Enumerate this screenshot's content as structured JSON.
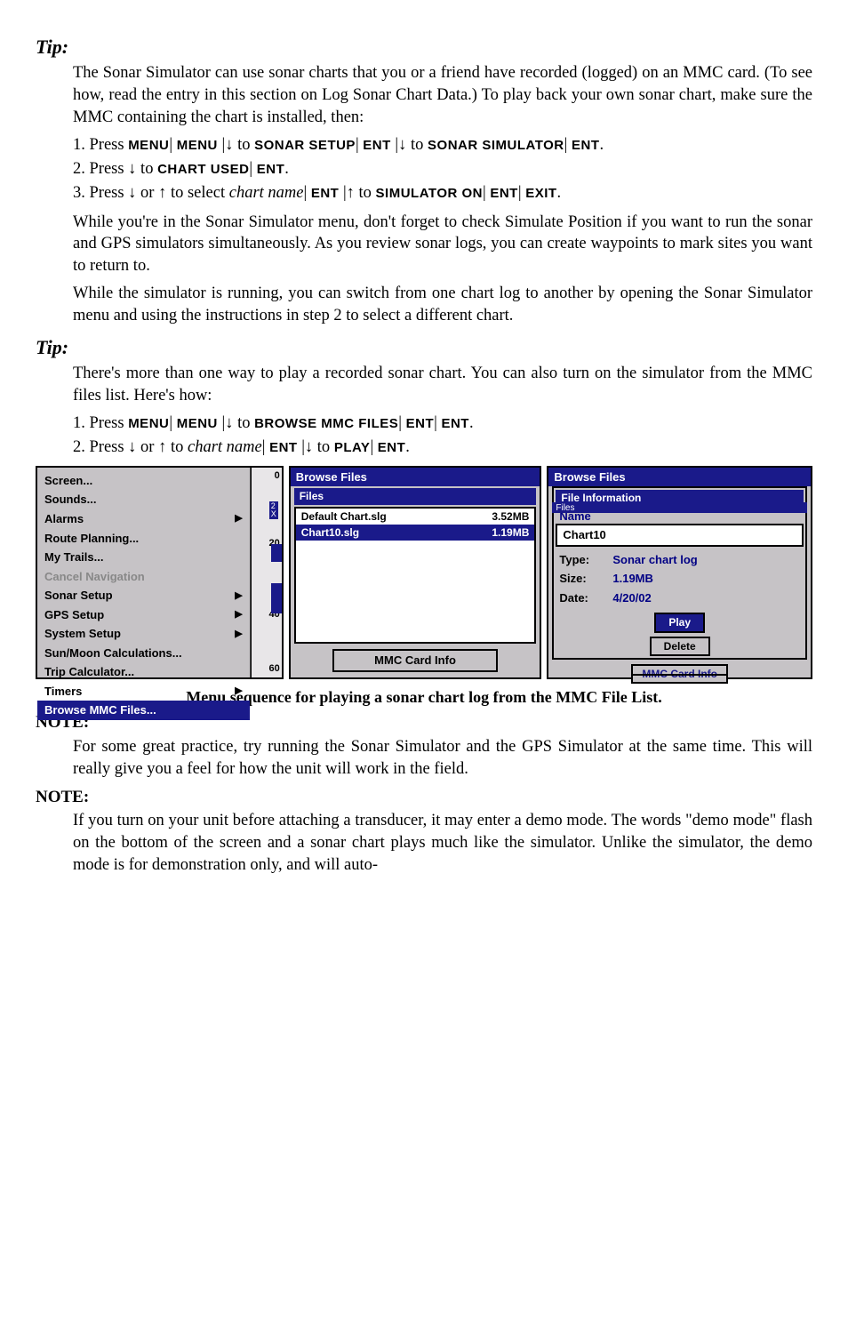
{
  "tip1": {
    "heading": "Tip:",
    "para": "The Sonar Simulator can use sonar charts that you or a friend have recorded (logged) on an MMC card. (To see how, read the entry in this section on Log Sonar Chart Data.) To play back your own sonar chart, make sure the MMC containing the chart is installed, then:",
    "step1_a": "1. Press ",
    "step1_b": "|↓ to ",
    "step1_c": "|↓ to ",
    "step1_menu": "MENU",
    "step1_menu2": "MENU",
    "step1_sonar": "SONAR SETUP",
    "step1_sim": "SONAR SIMULATOR",
    "step1_ent": "ENT",
    "step2_a": "2. Press ↓ to ",
    "step2_chart": "CHART USED",
    "step2_ent": "ENT",
    "step3_a": "3. Press ↓ or ↑ to select ",
    "step3_name": "chart name",
    "step3_b": "|↑ to ",
    "step3_ent": "ENT",
    "step3_sim": "SIMULATOR ON",
    "step3_ent2": "ENT",
    "step3_exit": "EXIT",
    "para2": "While you're in the Sonar Simulator menu, don't forget to check Simulate Position if you want to run the sonar and GPS simulators simultaneously. As you review sonar logs, you can create waypoints to mark sites you want to return to.",
    "para3": "While the simulator is running, you can switch from one chart log to another by opening the Sonar Simulator menu and using the instructions in step 2 to select a different chart."
  },
  "tip2": {
    "heading": "Tip:",
    "para": "There's more than one way to play a recorded sonar chart. You can also turn on the simulator from the MMC files list. Here's how:",
    "s1_a": "1. Press ",
    "s1_menu": "MENU",
    "s1_b": "|↓ to ",
    "s1_browse": "BROWSE MMC FILES",
    "s1_ent": "ENT",
    "s1_ent2": "ENT",
    "s2_a": "2. Press ↓ or ↑ to ",
    "s2_name": "chart name",
    "s2_ent": "ENT",
    "s2_b": "|↓ to ",
    "s2_play": "PLAY",
    "s2_ent2": "ENT"
  },
  "menu": {
    "items": [
      {
        "label": "Screen...",
        "arrow": false,
        "disabled": false
      },
      {
        "label": "Sounds...",
        "arrow": false,
        "disabled": false
      },
      {
        "label": "Alarms",
        "arrow": true,
        "disabled": false
      },
      {
        "label": "Route Planning...",
        "arrow": false,
        "disabled": false
      },
      {
        "label": "My Trails...",
        "arrow": false,
        "disabled": false
      },
      {
        "label": "Cancel Navigation",
        "arrow": false,
        "disabled": true
      },
      {
        "label": "Sonar Setup",
        "arrow": true,
        "disabled": false
      },
      {
        "label": "GPS Setup",
        "arrow": true,
        "disabled": false
      },
      {
        "label": "System Setup",
        "arrow": true,
        "disabled": false
      },
      {
        "label": "Sun/Moon Calculations...",
        "arrow": false,
        "disabled": false
      },
      {
        "label": "Trip Calculator...",
        "arrow": false,
        "disabled": false
      },
      {
        "label": "Timers",
        "arrow": true,
        "disabled": false
      },
      {
        "label": "Browse MMC Files...",
        "arrow": false,
        "disabled": false,
        "selected": true
      }
    ],
    "ruler": {
      "top": "0",
      "mid": "20",
      "mid2": "40",
      "bot": "60",
      "label2x": "2\nX"
    }
  },
  "browse": {
    "title": "Browse Files",
    "subtitle": "Files",
    "rows": [
      {
        "name": "Default Chart.slg",
        "size": "3.52MB"
      },
      {
        "name": "Chart10.slg",
        "size": "1.19MB",
        "selected": true
      }
    ],
    "btn": "MMC Card Info"
  },
  "info": {
    "title": "Browse Files",
    "strike": "Files",
    "sub": "File Information",
    "name_lbl": "Name",
    "name_val": "Chart10",
    "rows": [
      {
        "lbl": "Type:",
        "val": "Sonar chart log"
      },
      {
        "lbl": "Size:",
        "val": "1.19MB"
      },
      {
        "lbl": "Date:",
        "val": "4/20/02"
      }
    ],
    "play": "Play",
    "delete": "Delete",
    "card": "MMC Card Info"
  },
  "caption": "Menu sequence for playing a sonar chart log from the MMC File List.",
  "note1": {
    "heading": "NOTE:",
    "para": "For some great practice, try running the Sonar Simulator and the GPS Simulator at the same time. This will really give you a feel for how the unit will work in the field."
  },
  "note2": {
    "heading": "NOTE:",
    "para": "If you turn on your unit before attaching a transducer, it may enter a demo mode. The words \"demo mode\" flash on the bottom of the screen and a sonar chart plays much like the simulator. Unlike the simulator, the demo mode is for demonstration only, and will auto-"
  }
}
